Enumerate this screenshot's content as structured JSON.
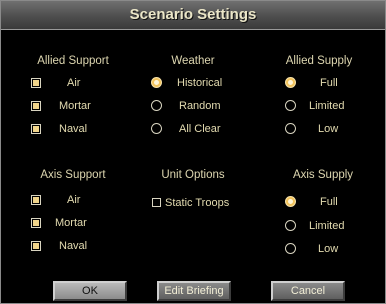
{
  "title": "Scenario Settings",
  "allied_support": {
    "title": "Allied Support",
    "items": [
      {
        "label": "Air",
        "checked": true
      },
      {
        "label": "Mortar",
        "checked": true
      },
      {
        "label": "Naval",
        "checked": true
      }
    ]
  },
  "weather": {
    "title": "Weather",
    "items": [
      {
        "label": "Historical",
        "selected": true
      },
      {
        "label": "Random",
        "selected": false
      },
      {
        "label": "All Clear",
        "selected": false
      }
    ]
  },
  "allied_supply": {
    "title": "Allied Supply",
    "items": [
      {
        "label": "Full",
        "selected": true
      },
      {
        "label": "Limited",
        "selected": false
      },
      {
        "label": "Low",
        "selected": false
      }
    ]
  },
  "axis_support": {
    "title": "Axis Support",
    "items": [
      {
        "label": "Air",
        "checked": true
      },
      {
        "label": "Mortar",
        "checked": true
      },
      {
        "label": "Naval",
        "checked": true
      }
    ]
  },
  "unit_options": {
    "title": "Unit Options",
    "items": [
      {
        "label": "Static Troops",
        "checked": false
      }
    ]
  },
  "axis_supply": {
    "title": "Axis Supply",
    "items": [
      {
        "label": "Full",
        "selected": true
      },
      {
        "label": "Limited",
        "selected": false
      },
      {
        "label": "Low",
        "selected": false
      }
    ]
  },
  "buttons": {
    "ok": "OK",
    "edit_briefing": "Edit Briefing",
    "cancel": "Cancel"
  },
  "colors": {
    "text": "#ddd6b0",
    "selected_radio": "#f3c45d",
    "background": "#000000",
    "titlebar": "#5a5a5a"
  }
}
